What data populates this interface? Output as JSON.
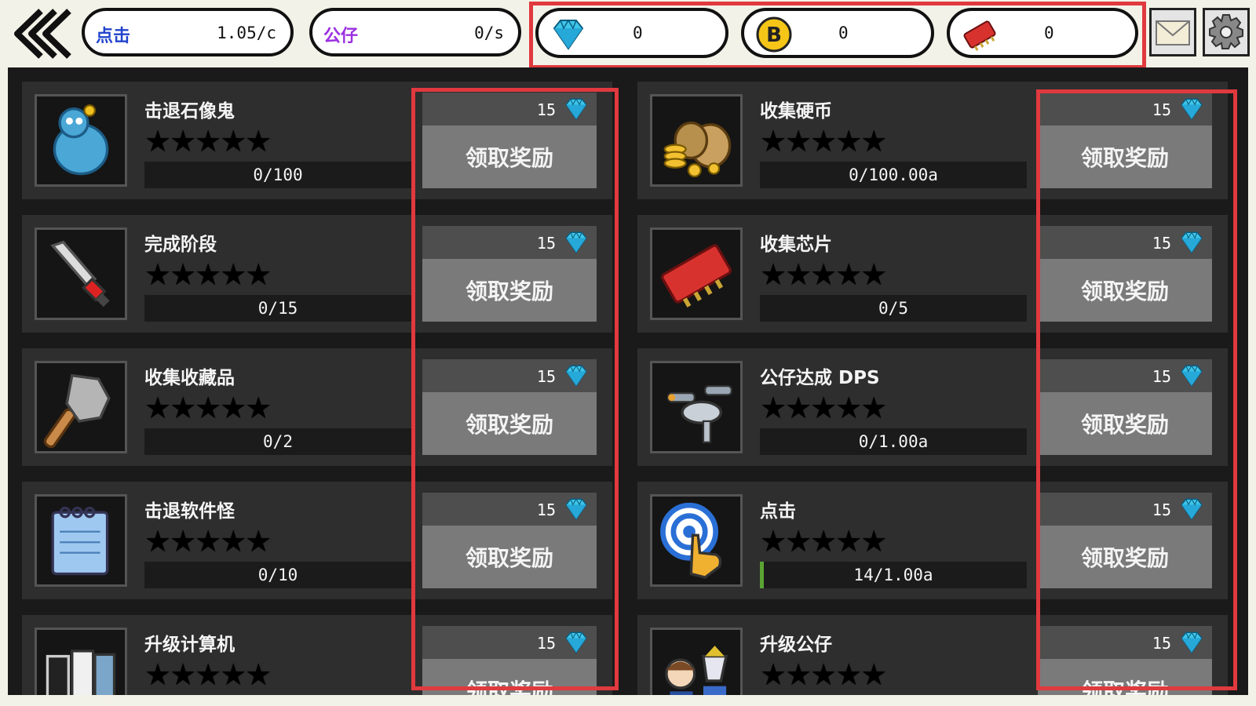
{
  "topbar": {
    "back_icon": "double-chevron-left-icon",
    "click_rate": {
      "label": "点击",
      "value": "1.05/c",
      "color": "#2244cc"
    },
    "dps_rate": {
      "label": "公仔",
      "value": "0/s",
      "color": "#9b30e0"
    },
    "currencies": [
      {
        "icon": "diamond-icon",
        "value": "0"
      },
      {
        "icon": "bitcoin-icon",
        "value": "0"
      },
      {
        "icon": "chip-icon",
        "value": "0"
      }
    ],
    "mail_icon": "mail-icon",
    "settings_icon": "gear-icon",
    "highlight_color": "#e0393e"
  },
  "achievements": {
    "left": [
      {
        "title": "击退石像鬼",
        "progress": "0/100",
        "fraction": 0,
        "stars": "★★★★★",
        "cost": "15",
        "claim": "领取奖励",
        "icon": "gargoyle-icon"
      },
      {
        "title": "完成阶段",
        "progress": "0/15",
        "fraction": 0,
        "stars": "★★★★★",
        "cost": "15",
        "claim": "领取奖励",
        "icon": "sword-icon"
      },
      {
        "title": "收集收藏品",
        "progress": "0/2",
        "fraction": 0,
        "stars": "★★★★★",
        "cost": "15",
        "claim": "领取奖励",
        "icon": "stone-club-icon"
      },
      {
        "title": "击退软件怪",
        "progress": "0/10",
        "fraction": 0,
        "stars": "★★★★★",
        "cost": "15",
        "claim": "领取奖励",
        "icon": "notepad-icon"
      },
      {
        "title": "升级计算机",
        "progress": "",
        "fraction": 0,
        "stars": "★★★★★",
        "cost": "15",
        "claim": "领取奖励",
        "icon": "computer-icon"
      }
    ],
    "right": [
      {
        "title": "收集硬币",
        "progress": "0/100.00a",
        "fraction": 0,
        "stars": "★★★★★",
        "cost": "15",
        "claim": "领取奖励",
        "icon": "coin-bags-icon"
      },
      {
        "title": "收集芯片",
        "progress": "0/5",
        "fraction": 0,
        "stars": "★★★★★",
        "cost": "15",
        "claim": "领取奖励",
        "icon": "chip-icon"
      },
      {
        "title": "公仔达成 DPS",
        "progress": "0/1.00a",
        "fraction": 0,
        "stars": "★★★★★",
        "cost": "15",
        "claim": "领取奖励",
        "icon": "spaceship-icon"
      },
      {
        "title": "点击",
        "progress": "14/1.00a",
        "fraction": 0.01,
        "stars": "★★★★★",
        "cost": "15",
        "claim": "领取奖励",
        "icon": "tap-target-icon"
      },
      {
        "title": "升级公仔",
        "progress": "",
        "fraction": 0,
        "stars": "★★★★★",
        "cost": "15",
        "claim": "领取奖励",
        "icon": "figurines-icon"
      }
    ]
  }
}
